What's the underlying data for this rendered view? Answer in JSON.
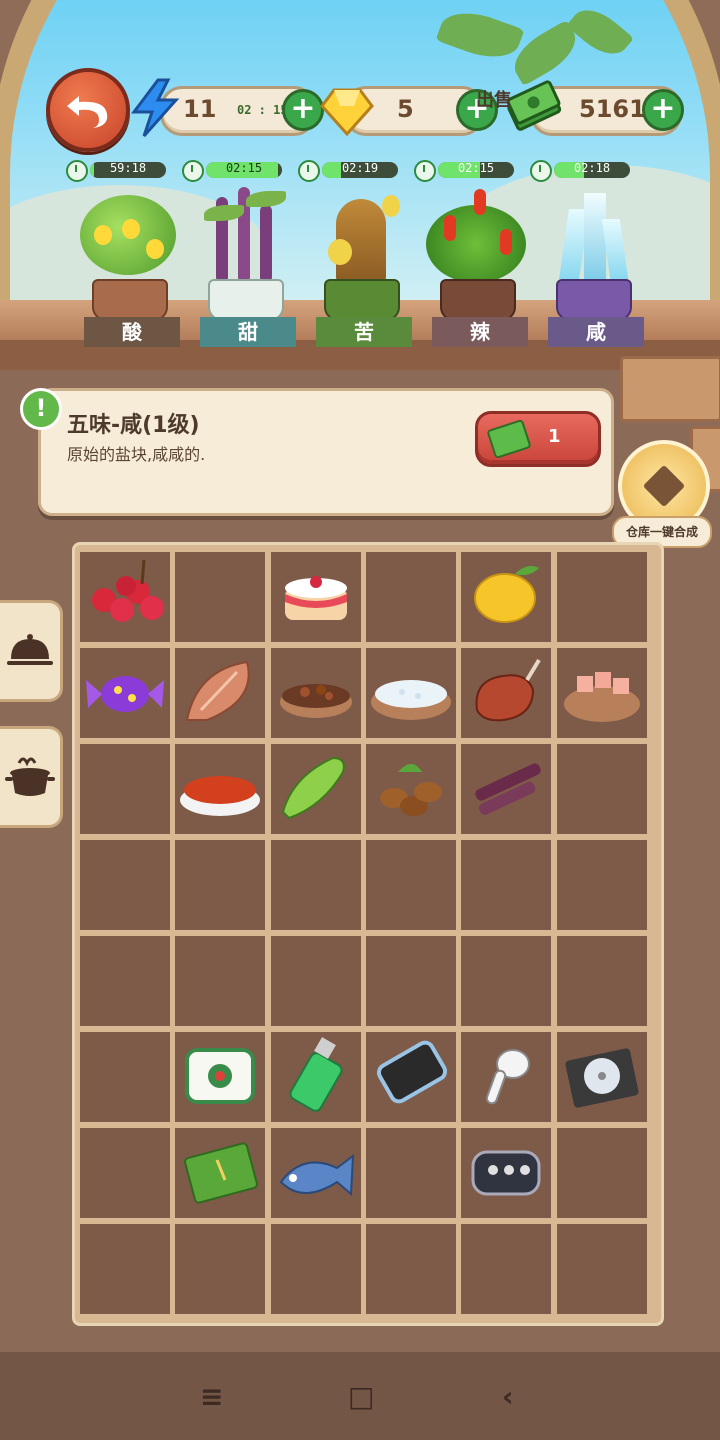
{
  "hud": {
    "energy": "11",
    "energy_timer": "02 : 15",
    "gems": "5",
    "cash": "51617",
    "plus": "+"
  },
  "plants": [
    {
      "name": "酸",
      "timer": "59:18",
      "progress": 0.05,
      "label_color": "#6e5644"
    },
    {
      "name": "甜",
      "timer": "02:15",
      "progress": 0.95,
      "label_color": "#4a8a8a"
    },
    {
      "name": "苦",
      "timer": "02:19",
      "progress": 0.25,
      "label_color": "#5a8a3c"
    },
    {
      "name": "辣",
      "timer": "02:15",
      "progress": 0.55,
      "label_color": "#7a5a5a"
    },
    {
      "name": "咸",
      "timer": "02:18",
      "progress": 0.4,
      "label_color": "#6a5a8a"
    }
  ],
  "info": {
    "title": "五味-咸(1级)",
    "description": "原始的盐块,咸咸的.",
    "sell_price": "1",
    "sell_label": "出售"
  },
  "merge": {
    "label": "仓库一键合成"
  },
  "side_tabs": [
    {
      "icon": "cloche-icon"
    },
    {
      "icon": "cooking-pot-icon"
    }
  ],
  "grid_items": [
    {
      "name": "bayberry-icon",
      "row": 0,
      "col": 0
    },
    {
      "name": "cake-icon",
      "row": 0,
      "col": 2
    },
    {
      "name": "lemon-icon",
      "row": 0,
      "col": 4
    },
    {
      "name": "candy-icon",
      "row": 1,
      "col": 0
    },
    {
      "name": "cured-fish-icon",
      "row": 1,
      "col": 1
    },
    {
      "name": "spice-bowl-icon",
      "row": 1,
      "col": 2
    },
    {
      "name": "salt-bowl-icon",
      "row": 1,
      "col": 3
    },
    {
      "name": "ham-icon",
      "row": 1,
      "col": 4
    },
    {
      "name": "salt-block-bowl-icon",
      "row": 1,
      "col": 5
    },
    {
      "name": "chili-powder-icon",
      "row": 2,
      "col": 1
    },
    {
      "name": "bitter-melon-icon",
      "row": 2,
      "col": 2
    },
    {
      "name": "coffee-beans-icon",
      "row": 2,
      "col": 3
    },
    {
      "name": "sugarcane-icon",
      "row": 2,
      "col": 4
    },
    {
      "name": "mahjong-tile-icon",
      "row": 5,
      "col": 1
    },
    {
      "name": "lighter-icon",
      "row": 5,
      "col": 2
    },
    {
      "name": "phone-icon",
      "row": 5,
      "col": 3
    },
    {
      "name": "earbud-icon",
      "row": 5,
      "col": 4
    },
    {
      "name": "cd-case-icon",
      "row": 5,
      "col": 5
    },
    {
      "name": "notebook-icon",
      "row": 6,
      "col": 1
    },
    {
      "name": "fish-icon",
      "row": 6,
      "col": 2
    },
    {
      "name": "car-key-icon",
      "row": 6,
      "col": 4
    }
  ],
  "navbar": {
    "menu": "≡",
    "home": "□",
    "back": "‹"
  }
}
